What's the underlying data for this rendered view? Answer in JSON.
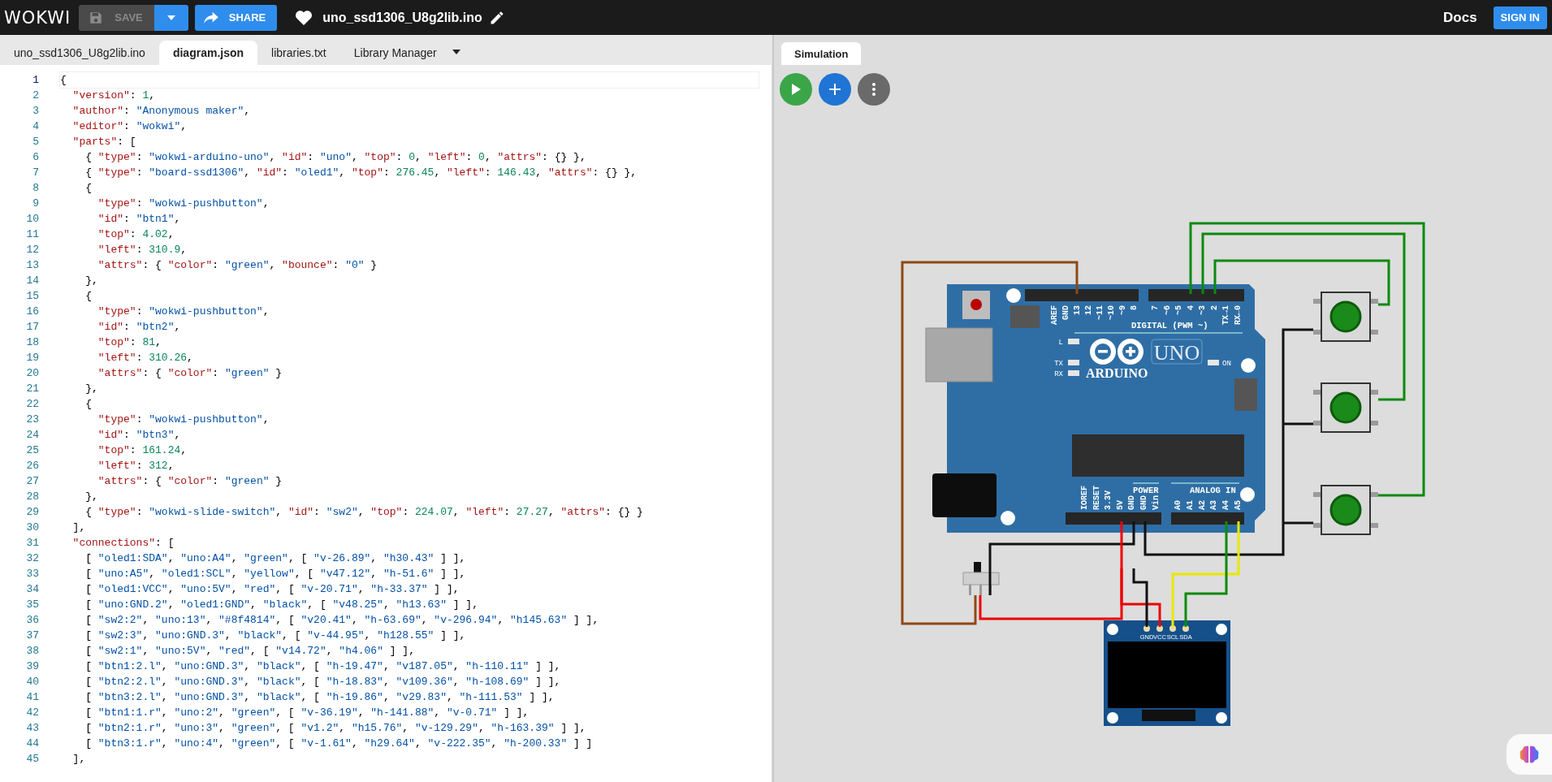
{
  "topbar": {
    "logo": "WOKWI",
    "save": {
      "label": "SAVE",
      "disabled": true
    },
    "share": "SHARE",
    "project_title": "uno_ssd1306_U8g2lib.ino",
    "docs": "Docs",
    "sign_in": "SIGN IN"
  },
  "editor_tabs": [
    {
      "label": "uno_ssd1306_U8g2lib.ino",
      "selected": false
    },
    {
      "label": "diagram.json",
      "selected": true
    },
    {
      "label": "libraries.txt",
      "selected": false
    },
    {
      "label": "Library Manager",
      "selected": false
    }
  ],
  "code": {
    "lines": [
      {
        "number": "1",
        "text": "{",
        "active": true
      },
      {
        "number": "2",
        "text": "  \"version\": 1,",
        "active": false
      },
      {
        "number": "3",
        "text": "  \"author\": \"Anonymous maker\",",
        "active": false
      },
      {
        "number": "4",
        "text": "  \"editor\": \"wokwi\",",
        "active": false
      },
      {
        "number": "5",
        "text": "  \"parts\": [",
        "active": false
      },
      {
        "number": "6",
        "text": "    { \"type\": \"wokwi-arduino-uno\", \"id\": \"uno\", \"top\": 0, \"left\": 0, \"attrs\": {} },",
        "active": false
      },
      {
        "number": "7",
        "text": "    { \"type\": \"board-ssd1306\", \"id\": \"oled1\", \"top\": 276.45, \"left\": 146.43, \"attrs\": {} },",
        "active": false
      },
      {
        "number": "8",
        "text": "    {",
        "active": false
      },
      {
        "number": "9",
        "text": "      \"type\": \"wokwi-pushbutton\",",
        "active": false
      },
      {
        "number": "10",
        "text": "      \"id\": \"btn1\",",
        "active": false
      },
      {
        "number": "11",
        "text": "      \"top\": 4.02,",
        "active": false
      },
      {
        "number": "12",
        "text": "      \"left\": 310.9,",
        "active": false
      },
      {
        "number": "13",
        "text": "      \"attrs\": { \"color\": \"green\", \"bounce\": \"0\" }",
        "active": false
      },
      {
        "number": "14",
        "text": "    },",
        "active": false
      },
      {
        "number": "15",
        "text": "    {",
        "active": false
      },
      {
        "number": "16",
        "text": "      \"type\": \"wokwi-pushbutton\",",
        "active": false
      },
      {
        "number": "17",
        "text": "      \"id\": \"btn2\",",
        "active": false
      },
      {
        "number": "18",
        "text": "      \"top\": 81,",
        "active": false
      },
      {
        "number": "19",
        "text": "      \"left\": 310.26,",
        "active": false
      },
      {
        "number": "20",
        "text": "      \"attrs\": { \"color\": \"green\" }",
        "active": false
      },
      {
        "number": "21",
        "text": "    },",
        "active": false
      },
      {
        "number": "22",
        "text": "    {",
        "active": false
      },
      {
        "number": "23",
        "text": "      \"type\": \"wokwi-pushbutton\",",
        "active": false
      },
      {
        "number": "24",
        "text": "      \"id\": \"btn3\",",
        "active": false
      },
      {
        "number": "25",
        "text": "      \"top\": 161.24,",
        "active": false
      },
      {
        "number": "26",
        "text": "      \"left\": 312,",
        "active": false
      },
      {
        "number": "27",
        "text": "      \"attrs\": { \"color\": \"green\" }",
        "active": false
      },
      {
        "number": "28",
        "text": "    },",
        "active": false
      },
      {
        "number": "29",
        "text": "    { \"type\": \"wokwi-slide-switch\", \"id\": \"sw2\", \"top\": 224.07, \"left\": 27.27, \"attrs\": {} }",
        "active": false
      },
      {
        "number": "30",
        "text": "  ],",
        "active": false
      },
      {
        "number": "31",
        "text": "  \"connections\": [",
        "active": false
      },
      {
        "number": "32",
        "text": "    [ \"oled1:SDA\", \"uno:A4\", \"green\", [ \"v-26.89\", \"h30.43\" ] ],",
        "active": false
      },
      {
        "number": "33",
        "text": "    [ \"uno:A5\", \"oled1:SCL\", \"yellow\", [ \"v47.12\", \"h-51.6\" ] ],",
        "active": false
      },
      {
        "number": "34",
        "text": "    [ \"oled1:VCC\", \"uno:5V\", \"red\", [ \"v-20.71\", \"h-33.37\" ] ],",
        "active": false
      },
      {
        "number": "35",
        "text": "    [ \"uno:GND.2\", \"oled1:GND\", \"black\", [ \"v48.25\", \"h13.63\" ] ],",
        "active": false
      },
      {
        "number": "36",
        "text": "    [ \"sw2:2\", \"uno:13\", \"#8f4814\", [ \"v20.41\", \"h-63.69\", \"v-296.94\", \"h145.63\" ] ],",
        "active": false
      },
      {
        "number": "37",
        "text": "    [ \"sw2:3\", \"uno:GND.3\", \"black\", [ \"v-44.95\", \"h128.55\" ] ],",
        "active": false
      },
      {
        "number": "38",
        "text": "    [ \"sw2:1\", \"uno:5V\", \"red\", [ \"v14.72\", \"h4.06\" ] ],",
        "active": false
      },
      {
        "number": "39",
        "text": "    [ \"btn1:2.l\", \"uno:GND.3\", \"black\", [ \"h-19.47\", \"v187.05\", \"h-110.11\" ] ],",
        "active": false
      },
      {
        "number": "40",
        "text": "    [ \"btn2:2.l\", \"uno:GND.3\", \"black\", [ \"h-18.83\", \"v109.36\", \"h-108.69\" ] ],",
        "active": false
      },
      {
        "number": "41",
        "text": "    [ \"btn3:2.l\", \"uno:GND.3\", \"black\", [ \"h-19.86\", \"v29.83\", \"h-111.53\" ] ],",
        "active": false
      },
      {
        "number": "42",
        "text": "    [ \"btn1:1.r\", \"uno:2\", \"green\", [ \"v-36.19\", \"h-141.88\", \"v-0.71\" ] ],",
        "active": false
      },
      {
        "number": "43",
        "text": "    [ \"btn2:1.r\", \"uno:3\", \"green\", [ \"v1.2\", \"h15.76\", \"v-129.29\", \"h-163.39\" ] ],",
        "active": false
      },
      {
        "number": "44",
        "text": "    [ \"btn3:1.r\", \"uno:4\", \"green\", [ \"v-1.61\", \"h29.64\", \"v-222.35\", \"h-200.33\" ] ]",
        "active": false
      },
      {
        "number": "45",
        "text": "  ],",
        "active": false
      }
    ]
  },
  "simulation": {
    "tab": {
      "label": "Simulation",
      "selected": true
    },
    "board": {
      "brand": "ARDUINO",
      "model": "UNO",
      "digital_title": "DIGITAL (PWM ~)",
      "power_title": "POWER",
      "analog_title": "ANALOG IN",
      "top_pins": [
        "AREF",
        "GND",
        "13",
        "12",
        "~11",
        "~10",
        "~9",
        "8"
      ],
      "digital_pins": [
        "7",
        "~6",
        "~5",
        "4",
        "~3",
        "2",
        "TX→1",
        "RX←0"
      ],
      "power_pins": [
        "IOREF",
        "RESET",
        "3.3V",
        "5V",
        "GND",
        "GND",
        "Vin"
      ],
      "analog_pins": [
        "A0",
        "A1",
        "A2",
        "A3",
        "A4",
        "A5"
      ],
      "led_labels": [
        "L",
        "TX",
        "RX"
      ],
      "power_led_label": "ON"
    },
    "oled": {
      "pins": [
        "GND",
        "VCC",
        "SCL",
        "SDA"
      ]
    },
    "slide_switch": {
      "on": false
    }
  }
}
